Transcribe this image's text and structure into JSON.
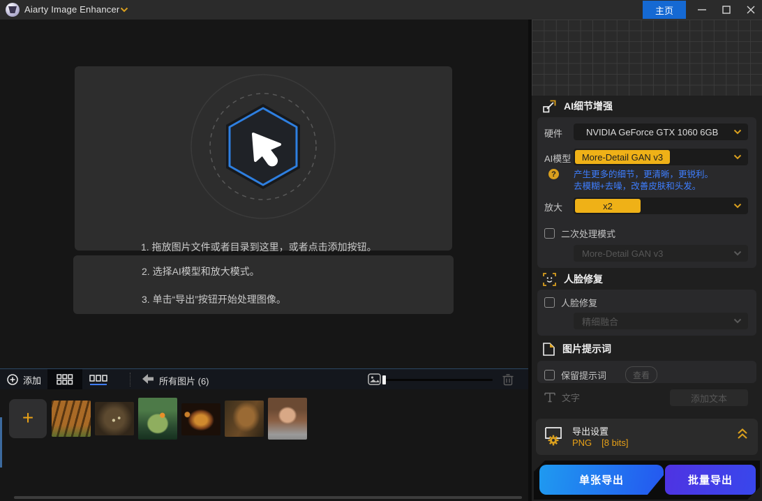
{
  "colors": {
    "accent_yellow": "#EFB117",
    "accent_blue": "#3E7EFF",
    "home_blue": "#1569D3",
    "single_export_gradient": [
      "#1F9AF0",
      "#2457F0"
    ],
    "batch_export_gradient": [
      "#4F33E2",
      "#3847EC"
    ]
  },
  "titlebar": {
    "app_title": "Aiarty Image Enhancer",
    "home_label": "主页"
  },
  "dropzone": {
    "step1": "1. 拖放图片文件或者目录到这里，或者点击添加按钮。",
    "step2": "2. 选择AI模型和放大模式。",
    "step3": "3. 单击“导出”按钮开始处理图像。"
  },
  "toolbar": {
    "add_label": "添加",
    "filter_label": "所有图片 (6)"
  },
  "thumbnails": {
    "count": 6,
    "items": [
      "tiger",
      "butterfly",
      "terrarium-jar",
      "burger",
      "robot-dog",
      "girl-portrait"
    ]
  },
  "panel": {
    "enhance": {
      "title": "AI细节增强",
      "hardware_label": "硬件",
      "hardware_value": "NVIDIA GeForce GTX 1060 6GB",
      "model_label": "AI模型",
      "model_value": "More-Detail GAN  v3",
      "model_desc_line1": "产生更多的细节，更清晰，更锐利。",
      "model_desc_line2": "去模糊+去噪，改善皮肤和头发。",
      "help_glyph": "?",
      "scale_label": "放大",
      "scale_value": "x2",
      "secondary_label": "二次处理模式",
      "secondary_model_value": "More-Detail GAN  v3"
    },
    "face": {
      "title": "人脸修复",
      "checkbox_label": "人脸修复",
      "mode_value": "精细融合"
    },
    "prompt": {
      "title": "图片提示词",
      "keep_label": "保留提示词",
      "view_button": "查看",
      "text_label": "文字",
      "add_text_button": "添加文本"
    },
    "export": {
      "title": "导出设置",
      "format": "PNG",
      "bits": "[8 bits]",
      "single_button": "单张导出",
      "batch_button": "批量导出"
    }
  },
  "icons": {
    "logo": "gem-circle",
    "title-dropdown": "chevron-down",
    "add": "plus-circle",
    "grid-view": "grid",
    "list-view": "list",
    "back": "arrow-left",
    "image": "picture",
    "trash": "trash-can",
    "enhance": "enlarge-arrows",
    "help": "question-circle",
    "face": "face-viewfinder",
    "prompt": "document-page",
    "text": "letter-T",
    "export": "monitor-gear",
    "collapse": "double-chevron-up"
  }
}
